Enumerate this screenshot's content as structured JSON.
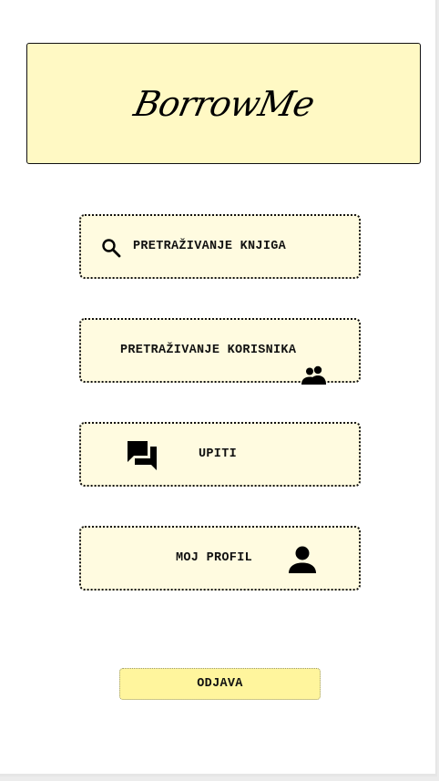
{
  "header": {
    "logo_text": "BorrowMe"
  },
  "menu": {
    "items": [
      {
        "label": "PRETRAŽIVANJE KNJIGA",
        "icon": "search-icon"
      },
      {
        "label": "PRETRAŽIVANJE KORISNIKA",
        "icon": "people-icon"
      },
      {
        "label": "UPITI",
        "icon": "chat-icon"
      },
      {
        "label": "MOJ PROFIL",
        "icon": "person-icon"
      }
    ]
  },
  "logout": {
    "label": "ODJAVA"
  },
  "colors": {
    "header_bg": "#fff9c4",
    "button_bg": "#fffbe0",
    "logout_bg": "#fff59d",
    "text": "#111111"
  }
}
